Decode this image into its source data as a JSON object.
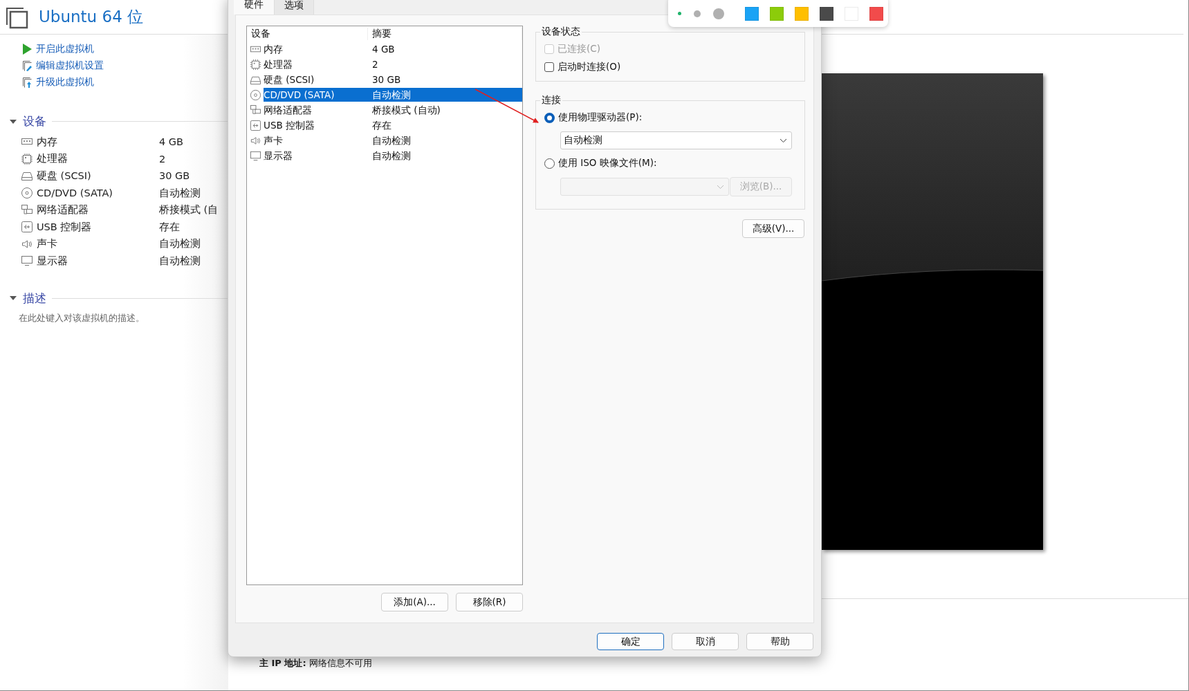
{
  "vm_title": "Ubuntu 64 位",
  "actions": [
    {
      "kind": "play",
      "label": "开启此虚拟机"
    },
    {
      "kind": "edit",
      "label": "编辑虚拟机设置"
    },
    {
      "kind": "upgrade",
      "label": "升级此虚拟机"
    }
  ],
  "devices_section": {
    "title": "设备",
    "expanded": true,
    "items": [
      {
        "kind": "memory",
        "name": "内存",
        "summary": "4 GB"
      },
      {
        "kind": "cpu",
        "name": "处理器",
        "summary": "2"
      },
      {
        "kind": "disk",
        "name": "硬盘 (SCSI)",
        "summary": "30 GB"
      },
      {
        "kind": "cdrom",
        "name": "CD/DVD (SATA)",
        "summary": "自动检测"
      },
      {
        "kind": "network",
        "name": "网络适配器",
        "summary": "桥接模式 (自"
      },
      {
        "kind": "usb",
        "name": "USB 控制器",
        "summary": "存在"
      },
      {
        "kind": "sound",
        "name": "声卡",
        "summary": "自动检测"
      },
      {
        "kind": "display",
        "name": "显示器",
        "summary": "自动检测"
      }
    ]
  },
  "description_section": {
    "title": "描述",
    "expanded": true,
    "text": "在此处键入对该虚拟机的描述。"
  },
  "ip_line": {
    "label": "主 IP 地址:",
    "value": "网络信息不可用"
  },
  "dialog": {
    "tabs": [
      {
        "label": "硬件",
        "selected": true
      },
      {
        "label": "选项",
        "selected": false
      }
    ],
    "hardware": {
      "columns": [
        "设备",
        "摘要"
      ],
      "rows": [
        {
          "kind": "memory",
          "name": "内存",
          "summary": "4 GB",
          "selected": false
        },
        {
          "kind": "cpu",
          "name": "处理器",
          "summary": "2",
          "selected": false
        },
        {
          "kind": "disk",
          "name": "硬盘 (SCSI)",
          "summary": "30 GB",
          "selected": false
        },
        {
          "kind": "cdrom",
          "name": "CD/DVD (SATA)",
          "summary": "自动检测",
          "selected": true
        },
        {
          "kind": "network",
          "name": "网络适配器",
          "summary": "桥接模式 (自动)",
          "selected": false
        },
        {
          "kind": "usb",
          "name": "USB 控制器",
          "summary": "存在",
          "selected": false
        },
        {
          "kind": "sound",
          "name": "声卡",
          "summary": "自动检测",
          "selected": false
        },
        {
          "kind": "display",
          "name": "显示器",
          "summary": "自动检测",
          "selected": false
        }
      ]
    },
    "list_buttons": [
      "添加(A)...",
      "移除(R)"
    ],
    "device_status": {
      "title": "设备状态",
      "options": [
        {
          "label": "已连接(C)",
          "checked": false,
          "disabled": true
        },
        {
          "label": "启动时连接(O)",
          "checked": false,
          "disabled": false
        }
      ]
    },
    "connection": {
      "title": "连接",
      "options": [
        {
          "label": "使用物理驱动器(P):",
          "selected": true,
          "field": {
            "value": "自动检测",
            "disabled": false
          }
        },
        {
          "label": "使用 ISO 映像文件(M):",
          "selected": false,
          "field": {
            "disabled": true
          },
          "button": {
            "label": "浏览(B)...",
            "disabled": true
          }
        }
      ]
    },
    "advanced_button": "高级(V)...",
    "footer_buttons": [
      {
        "label": "确定",
        "default": true
      },
      {
        "label": "取消",
        "default": false
      },
      {
        "label": "帮助",
        "default": false
      }
    ]
  },
  "annotation_toolbar": {
    "pen_sizes": [
      {
        "selected": true
      },
      {
        "selected": false
      },
      {
        "selected": false
      }
    ],
    "colors": [
      {
        "color": "#1aa3f5"
      },
      {
        "color": "#8ccc0a"
      },
      {
        "color": "#ffbf00"
      },
      {
        "color": "#4a4a4a"
      },
      {
        "color": "#ffffff"
      },
      {
        "color": "#f24b4b"
      }
    ]
  }
}
